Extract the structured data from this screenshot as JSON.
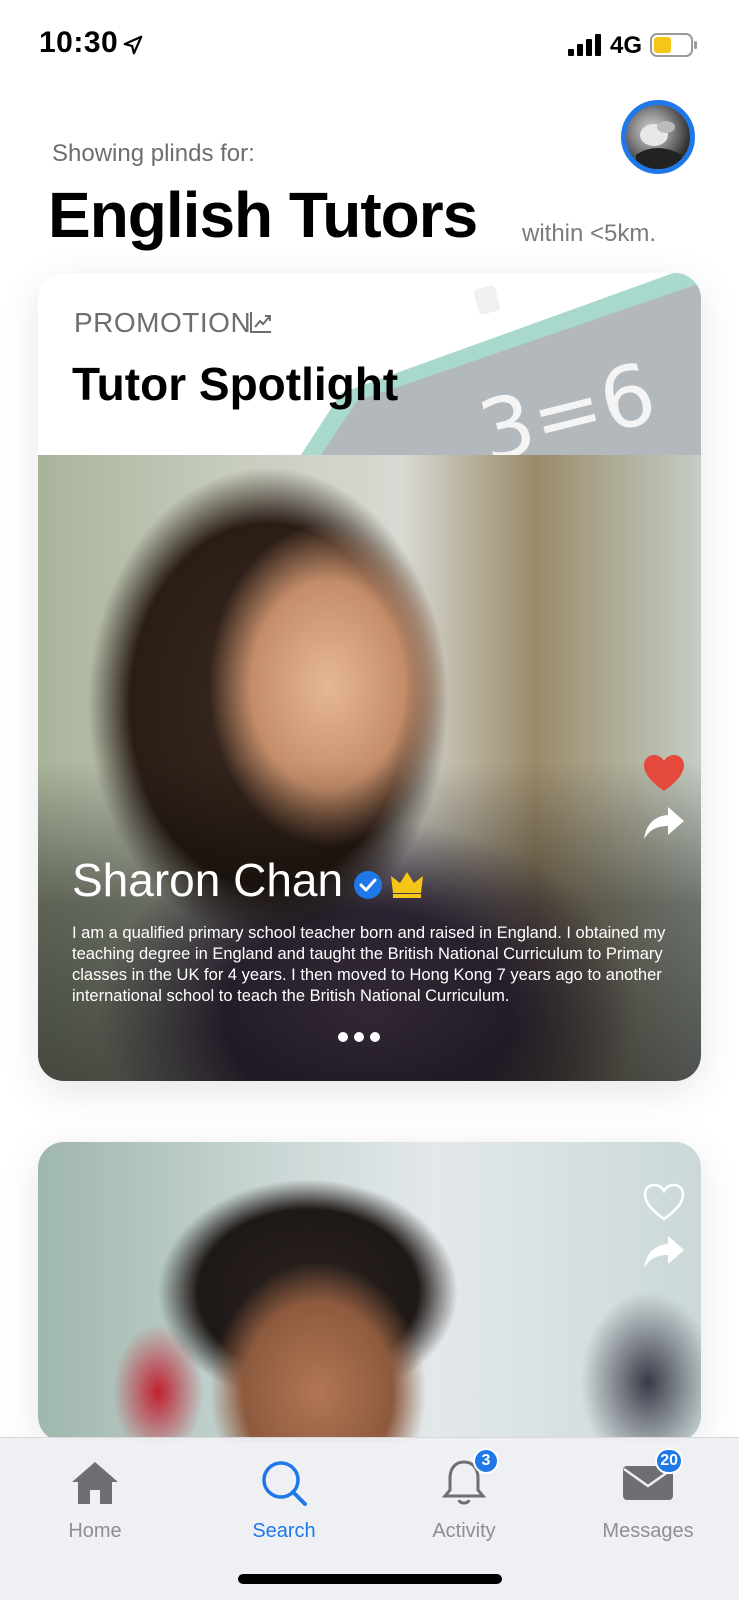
{
  "status_bar": {
    "time": "10:30",
    "network": "4G",
    "icons": [
      "location-arrow-icon",
      "signal-icon",
      "battery-icon"
    ],
    "battery_color": "#f5c518"
  },
  "header": {
    "showing_label": "Showing plinds for:",
    "title": "English Tutors",
    "distance": "within <5km.",
    "avatar_icon": "user-avatar"
  },
  "promo_card": {
    "label": "PROMOTION",
    "label_icon": "trend-chart-icon",
    "title": "Tutor Spotlight",
    "chalkboard_text": "3=6",
    "tutor": {
      "name": "Sharon Chan",
      "verified": true,
      "premium": true,
      "liked": true,
      "bio": "I am a qualified primary school teacher born and raised in England. I obtained my teaching degree in England and taught the British National Curriculum to Primary classes in the UK for 4 years. I then moved to Hong Kong 7 years ago to another international school to teach the British National Curriculum."
    },
    "page_dots": 3
  },
  "second_card": {
    "liked": false
  },
  "tab_bar": {
    "tabs": [
      {
        "label": "Home",
        "icon": "home-icon",
        "active": false
      },
      {
        "label": "Search",
        "icon": "search-icon",
        "active": true
      },
      {
        "label": "Activity",
        "icon": "bell-icon",
        "active": false,
        "badge": "3"
      },
      {
        "label": "Messages",
        "icon": "envelope-icon",
        "active": false,
        "badge": "20"
      }
    ]
  },
  "colors": {
    "accent": "#1f78e8",
    "heart": "#e5493d",
    "crown": "#f5c518",
    "inactive_tab": "#8e8e93"
  }
}
